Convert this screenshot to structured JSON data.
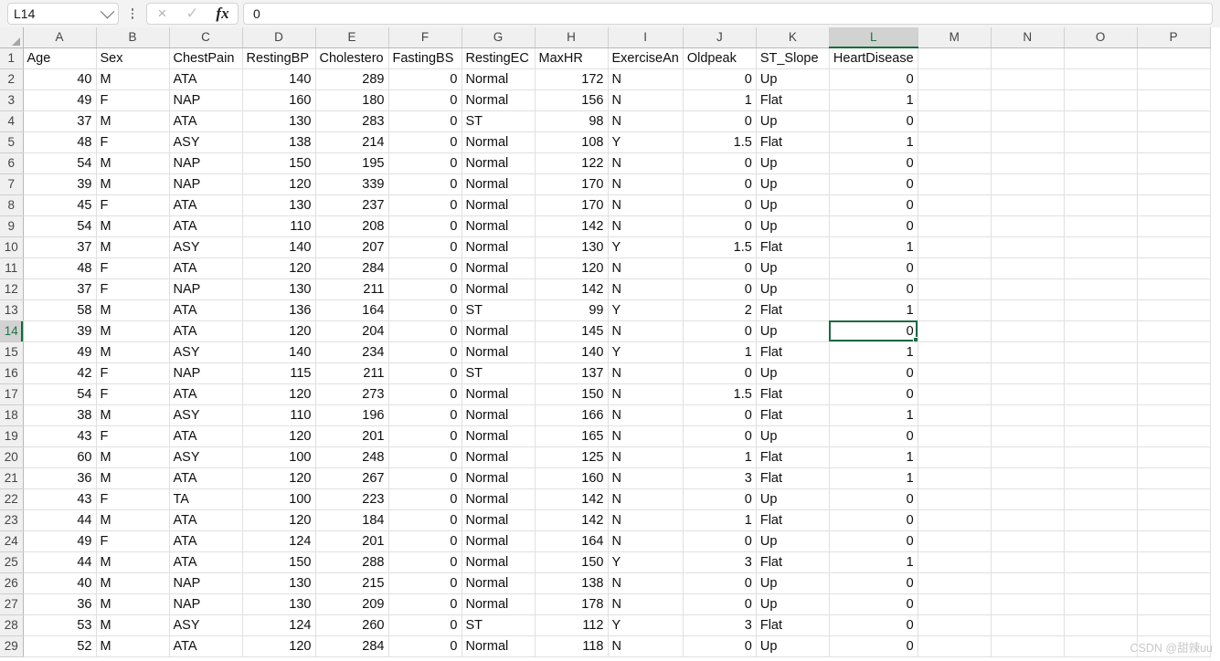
{
  "formula_bar": {
    "name_box_value": "L14",
    "formula_value": "0",
    "icons": {
      "chevron": "chevron-down-icon",
      "dots": "more-options-icon",
      "cancel": "×",
      "confirm": "✓",
      "fx": "fx"
    }
  },
  "grid": {
    "columns": [
      "A",
      "B",
      "C",
      "D",
      "E",
      "F",
      "G",
      "H",
      "I",
      "J",
      "K",
      "L",
      "M",
      "N",
      "O",
      "P"
    ],
    "selected_column": "L",
    "selected_row": 14,
    "selected_cell": "L14",
    "row_numbers": [
      1,
      2,
      3,
      4,
      5,
      6,
      7,
      8,
      9,
      10,
      11,
      12,
      13,
      14,
      15,
      16,
      17,
      18,
      19,
      20,
      21,
      22,
      23,
      24,
      25,
      26,
      27,
      28,
      29
    ],
    "header_row": [
      "Age",
      "Sex",
      "ChestPain",
      "RestingBP",
      "Cholestero",
      "FastingBS",
      "RestingEC",
      "MaxHR",
      "ExerciseAn",
      "Oldpeak",
      "ST_Slope",
      "HeartDisease",
      "",
      "",
      "",
      ""
    ],
    "align": [
      "num",
      "txt",
      "txt",
      "num",
      "num",
      "num",
      "txt",
      "num",
      "txt",
      "num",
      "txt",
      "num",
      "txt",
      "txt",
      "txt",
      "txt"
    ],
    "rows": [
      [
        "40",
        "M",
        "ATA",
        "140",
        "289",
        "0",
        "Normal",
        "172",
        "N",
        "0",
        "Up",
        "0",
        "",
        "",
        "",
        ""
      ],
      [
        "49",
        "F",
        "NAP",
        "160",
        "180",
        "0",
        "Normal",
        "156",
        "N",
        "1",
        "Flat",
        "1",
        "",
        "",
        "",
        ""
      ],
      [
        "37",
        "M",
        "ATA",
        "130",
        "283",
        "0",
        "ST",
        "98",
        "N",
        "0",
        "Up",
        "0",
        "",
        "",
        "",
        ""
      ],
      [
        "48",
        "F",
        "ASY",
        "138",
        "214",
        "0",
        "Normal",
        "108",
        "Y",
        "1.5",
        "Flat",
        "1",
        "",
        "",
        "",
        ""
      ],
      [
        "54",
        "M",
        "NAP",
        "150",
        "195",
        "0",
        "Normal",
        "122",
        "N",
        "0",
        "Up",
        "0",
        "",
        "",
        "",
        ""
      ],
      [
        "39",
        "M",
        "NAP",
        "120",
        "339",
        "0",
        "Normal",
        "170",
        "N",
        "0",
        "Up",
        "0",
        "",
        "",
        "",
        ""
      ],
      [
        "45",
        "F",
        "ATA",
        "130",
        "237",
        "0",
        "Normal",
        "170",
        "N",
        "0",
        "Up",
        "0",
        "",
        "",
        "",
        ""
      ],
      [
        "54",
        "M",
        "ATA",
        "110",
        "208",
        "0",
        "Normal",
        "142",
        "N",
        "0",
        "Up",
        "0",
        "",
        "",
        "",
        ""
      ],
      [
        "37",
        "M",
        "ASY",
        "140",
        "207",
        "0",
        "Normal",
        "130",
        "Y",
        "1.5",
        "Flat",
        "1",
        "",
        "",
        "",
        ""
      ],
      [
        "48",
        "F",
        "ATA",
        "120",
        "284",
        "0",
        "Normal",
        "120",
        "N",
        "0",
        "Up",
        "0",
        "",
        "",
        "",
        ""
      ],
      [
        "37",
        "F",
        "NAP",
        "130",
        "211",
        "0",
        "Normal",
        "142",
        "N",
        "0",
        "Up",
        "0",
        "",
        "",
        "",
        ""
      ],
      [
        "58",
        "M",
        "ATA",
        "136",
        "164",
        "0",
        "ST",
        "99",
        "Y",
        "2",
        "Flat",
        "1",
        "",
        "",
        "",
        ""
      ],
      [
        "39",
        "M",
        "ATA",
        "120",
        "204",
        "0",
        "Normal",
        "145",
        "N",
        "0",
        "Up",
        "0",
        "",
        "",
        "",
        ""
      ],
      [
        "49",
        "M",
        "ASY",
        "140",
        "234",
        "0",
        "Normal",
        "140",
        "Y",
        "1",
        "Flat",
        "1",
        "",
        "",
        "",
        ""
      ],
      [
        "42",
        "F",
        "NAP",
        "115",
        "211",
        "0",
        "ST",
        "137",
        "N",
        "0",
        "Up",
        "0",
        "",
        "",
        "",
        ""
      ],
      [
        "54",
        "F",
        "ATA",
        "120",
        "273",
        "0",
        "Normal",
        "150",
        "N",
        "1.5",
        "Flat",
        "0",
        "",
        "",
        "",
        ""
      ],
      [
        "38",
        "M",
        "ASY",
        "110",
        "196",
        "0",
        "Normal",
        "166",
        "N",
        "0",
        "Flat",
        "1",
        "",
        "",
        "",
        ""
      ],
      [
        "43",
        "F",
        "ATA",
        "120",
        "201",
        "0",
        "Normal",
        "165",
        "N",
        "0",
        "Up",
        "0",
        "",
        "",
        "",
        ""
      ],
      [
        "60",
        "M",
        "ASY",
        "100",
        "248",
        "0",
        "Normal",
        "125",
        "N",
        "1",
        "Flat",
        "1",
        "",
        "",
        "",
        ""
      ],
      [
        "36",
        "M",
        "ATA",
        "120",
        "267",
        "0",
        "Normal",
        "160",
        "N",
        "3",
        "Flat",
        "1",
        "",
        "",
        "",
        ""
      ],
      [
        "43",
        "F",
        "TA",
        "100",
        "223",
        "0",
        "Normal",
        "142",
        "N",
        "0",
        "Up",
        "0",
        "",
        "",
        "",
        ""
      ],
      [
        "44",
        "M",
        "ATA",
        "120",
        "184",
        "0",
        "Normal",
        "142",
        "N",
        "1",
        "Flat",
        "0",
        "",
        "",
        "",
        ""
      ],
      [
        "49",
        "F",
        "ATA",
        "124",
        "201",
        "0",
        "Normal",
        "164",
        "N",
        "0",
        "Up",
        "0",
        "",
        "",
        "",
        ""
      ],
      [
        "44",
        "M",
        "ATA",
        "150",
        "288",
        "0",
        "Normal",
        "150",
        "Y",
        "3",
        "Flat",
        "1",
        "",
        "",
        "",
        ""
      ],
      [
        "40",
        "M",
        "NAP",
        "130",
        "215",
        "0",
        "Normal",
        "138",
        "N",
        "0",
        "Up",
        "0",
        "",
        "",
        "",
        ""
      ],
      [
        "36",
        "M",
        "NAP",
        "130",
        "209",
        "0",
        "Normal",
        "178",
        "N",
        "0",
        "Up",
        "0",
        "",
        "",
        "",
        ""
      ],
      [
        "53",
        "M",
        "ASY",
        "124",
        "260",
        "0",
        "ST",
        "112",
        "Y",
        "3",
        "Flat",
        "0",
        "",
        "",
        "",
        ""
      ],
      [
        "52",
        "M",
        "ATA",
        "120",
        "284",
        "0",
        "Normal",
        "118",
        "N",
        "0",
        "Up",
        "0",
        "",
        "",
        "",
        ""
      ]
    ]
  },
  "watermark": "CSDN @甜辣uu",
  "colors": {
    "selection_green": "#1b6b45",
    "header_grey": "#f0f0f0",
    "selected_header_grey": "#d2d2d2"
  }
}
